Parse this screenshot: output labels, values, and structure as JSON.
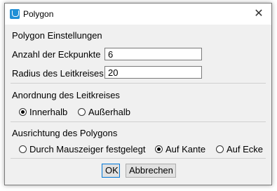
{
  "window": {
    "title": "Polygon",
    "close_glyph": "✕"
  },
  "settings": {
    "heading": "Polygon Einstellungen",
    "vertices_label": "Anzahl der Eckpunkte",
    "vertices_value": "6",
    "radius_label": "Radius des Leitkreises",
    "radius_value": "20"
  },
  "arrangement": {
    "heading": "Anordnung des Leitkreises",
    "inside_label": "Innerhalb",
    "outside_label": "Außerhalb",
    "selected": "inside"
  },
  "orientation": {
    "heading": "Ausrichtung des Polygons",
    "mouse_label": "Durch Mauszeiger festgelegt",
    "edge_label": "Auf Kante",
    "corner_label": "Auf Ecke",
    "selected": "edge"
  },
  "buttons": {
    "ok_label": "OK",
    "cancel_label": "Abbrechen"
  }
}
